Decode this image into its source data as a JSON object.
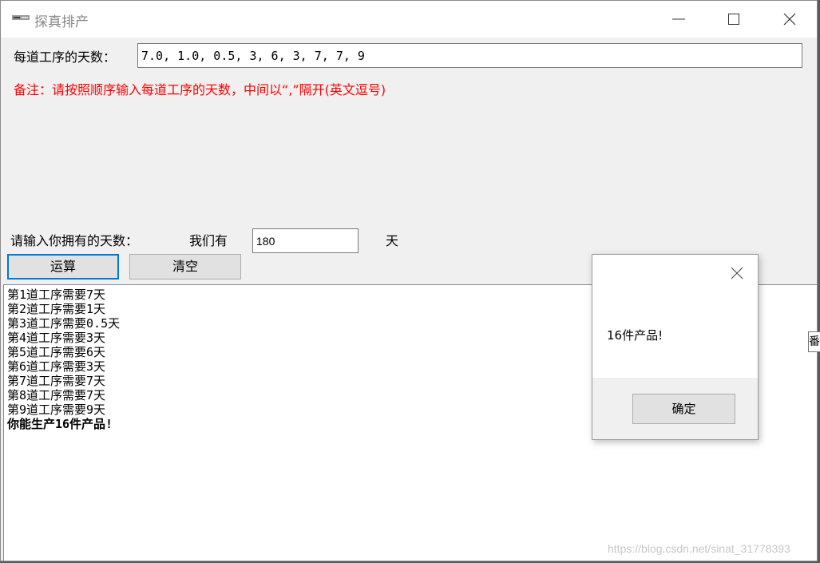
{
  "window": {
    "title": "探真排产"
  },
  "form": {
    "steps_label": "每道工序的天数：",
    "steps_value": "7.0, 1.0, 0.5, 3, 6, 3, 7, 7, 9",
    "note": "备注：请按照顺序输入每道工序的天数，中间以“,”隔开(英文逗号)",
    "days_label": "请输入你拥有的天数：",
    "we_have_label": "我们有",
    "days_value": "180",
    "unit": "天",
    "calc_button": "运算",
    "clear_button": "清空"
  },
  "output": {
    "lines": [
      "第1道工序需要7天",
      "第2道工序需要1天",
      "第3道工序需要0.5天",
      "第4道工序需要3天",
      "第5道工序需要6天",
      "第6道工序需要3天",
      "第7道工序需要7天",
      "第8道工序需要7天",
      "第9道工序需要9天"
    ],
    "result": "你能生产16件产品!"
  },
  "message_box": {
    "text": "16件产品!",
    "ok_button": "确定"
  },
  "side_tab": "番",
  "watermark": "https://blog.csdn.net/sinat_31778393",
  "colors": {
    "note": "#ff0000",
    "focus_border": "#0078d7"
  }
}
